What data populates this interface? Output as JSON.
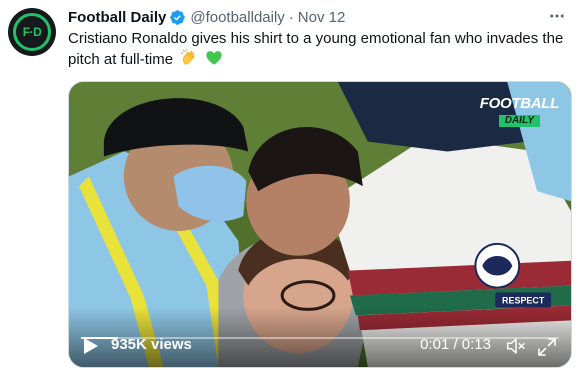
{
  "account": {
    "display_name": "Football Daily",
    "handle": "@footballdaily",
    "separator": "·",
    "date": "Nov 12",
    "avatar_text": "F·D",
    "verified": true
  },
  "tweet": {
    "text": "Cristiano Ronaldo gives his shirt to a young emotional fan who invades the pitch at full-time",
    "emojis": [
      "clapping-hands",
      "green-heart"
    ]
  },
  "media": {
    "watermark_top": "FOOTBALL",
    "watermark_bottom": "DAILY",
    "views": "935K views",
    "timecode": "0:01 / 0:13",
    "progress": 0.077,
    "shirt_print": "RESPECT"
  },
  "colors": {
    "brand_green": "#21c26b",
    "verified_blue": "#1d9bf0",
    "secondary_text": "#536471"
  },
  "icons": {
    "more": "more-dots-icon",
    "play": "play-icon",
    "sound": "speaker-muted-icon",
    "fullscreen": "fullscreen-icon"
  }
}
